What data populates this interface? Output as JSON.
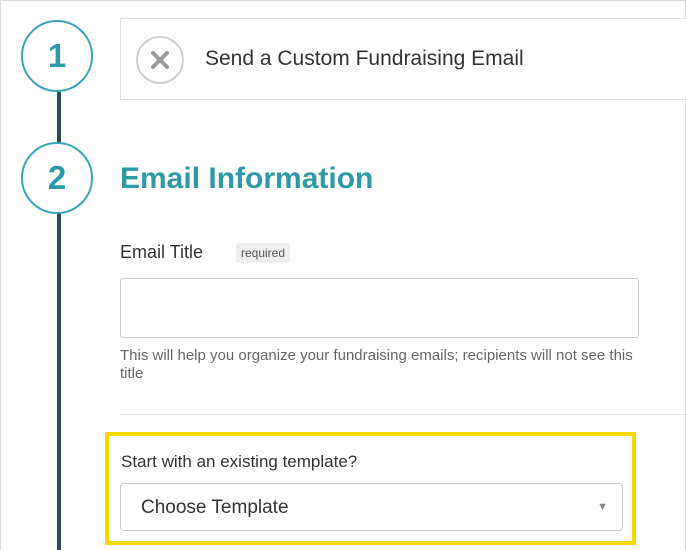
{
  "steps": [
    {
      "number": "1"
    },
    {
      "number": "2"
    }
  ],
  "collapsed_step": {
    "title": "Send a Custom Fundraising Email",
    "close_icon": "close-icon"
  },
  "section": {
    "title": "Email Information"
  },
  "email_title_field": {
    "label": "Email Title",
    "badge": "required",
    "value": "",
    "placeholder": "",
    "help_text": "This will help you organize your fundraising emails; recipients will not see this title"
  },
  "template_field": {
    "label": "Start with an existing template?",
    "selected": "Choose Template",
    "arrow_icon": "chevron-down-icon"
  },
  "colors": {
    "accent": "#2e9aa8",
    "timeline": "#2d4a5a",
    "highlight": "#f6d800"
  }
}
